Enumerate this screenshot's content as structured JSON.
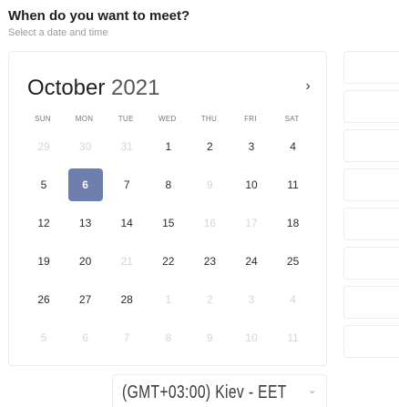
{
  "header": {
    "title": "When do you want to meet?",
    "subtitle": "Select a date and time"
  },
  "calendar": {
    "month": "October",
    "year": "2021",
    "next_icon": "chevron-right-icon",
    "weekdays": [
      "SUN",
      "MON",
      "TUE",
      "WED",
      "THU",
      "FRI",
      "SAT"
    ],
    "selected_color": "#6e7ead",
    "weeks": [
      [
        {
          "d": "29",
          "m": true
        },
        {
          "d": "30",
          "m": true
        },
        {
          "d": "31",
          "m": true
        },
        {
          "d": "1"
        },
        {
          "d": "2"
        },
        {
          "d": "3"
        },
        {
          "d": "4"
        }
      ],
      [
        {
          "d": "5"
        },
        {
          "d": "6",
          "s": true
        },
        {
          "d": "7"
        },
        {
          "d": "8"
        },
        {
          "d": "9",
          "m": true
        },
        {
          "d": "10"
        },
        {
          "d": "11"
        }
      ],
      [
        {
          "d": "12"
        },
        {
          "d": "13"
        },
        {
          "d": "14"
        },
        {
          "d": "15"
        },
        {
          "d": "16",
          "m": true
        },
        {
          "d": "17",
          "m": true
        },
        {
          "d": "18"
        }
      ],
      [
        {
          "d": "19"
        },
        {
          "d": "20"
        },
        {
          "d": "21",
          "m": true
        },
        {
          "d": "22"
        },
        {
          "d": "23"
        },
        {
          "d": "24"
        },
        {
          "d": "25"
        }
      ],
      [
        {
          "d": "26"
        },
        {
          "d": "27"
        },
        {
          "d": "28"
        },
        {
          "d": "1",
          "m": true
        },
        {
          "d": "2",
          "m": true
        },
        {
          "d": "3",
          "m": true
        },
        {
          "d": "4",
          "m": true
        }
      ],
      [
        {
          "d": "5",
          "m": true
        },
        {
          "d": "6",
          "m": true
        },
        {
          "d": "7",
          "m": true
        },
        {
          "d": "8",
          "m": true
        },
        {
          "d": "9",
          "m": true
        },
        {
          "d": "10",
          "m": true
        },
        {
          "d": "11",
          "m": true
        }
      ]
    ]
  },
  "timezone": {
    "label": "(GMT+03:00) Kiev - EET",
    "chevron_icon": "chevron-down-icon"
  },
  "time_slots": {
    "count_visible": 8
  }
}
